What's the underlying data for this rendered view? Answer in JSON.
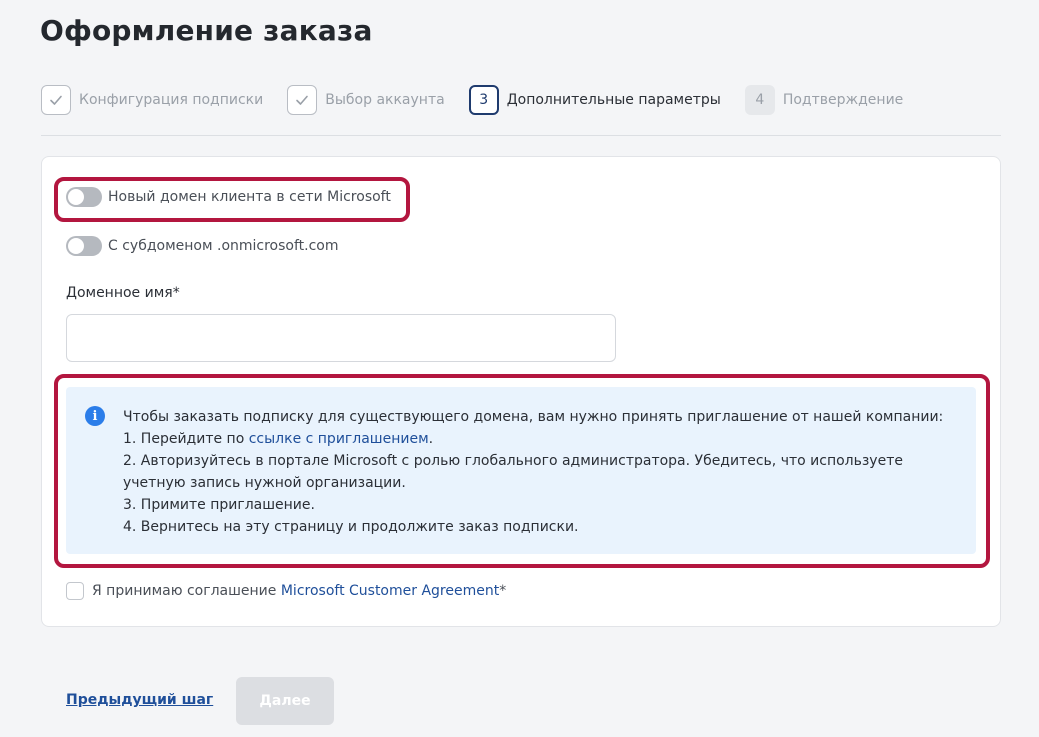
{
  "page": {
    "title": "Оформление заказа"
  },
  "stepper": {
    "steps": [
      {
        "label": "Конфигурация подписки",
        "state": "done",
        "number": ""
      },
      {
        "label": "Выбор аккаунта",
        "state": "done",
        "number": ""
      },
      {
        "label": "Дополнительные параметры",
        "state": "current",
        "number": "3"
      },
      {
        "label": "Подтверждение",
        "state": "future",
        "number": "4"
      }
    ]
  },
  "form": {
    "toggle_new_domain": {
      "label": "Новый домен клиента в сети Microsoft",
      "checked": false
    },
    "toggle_subdomain": {
      "label": "С субдоменом .onmicrosoft.com",
      "checked": false
    },
    "domain_name": {
      "label": "Доменное имя*",
      "value": "",
      "placeholder": ""
    },
    "info": {
      "icon": "info-icon",
      "intro": "Чтобы заказать подписку для существующего домена, вам нужно принять приглашение от нашей компании:",
      "step1_prefix": "1. Перейдите по ",
      "step1_link": "ссылке с приглашением",
      "step1_suffix": ".",
      "step2": "2. Авторизуйтесь в портале Microsoft с ролью глобального администратора. Убедитесь, что используете учетную запись нужной организации.",
      "step3": "3. Примите приглашение.",
      "step4": "4. Вернитесь на эту страницу и продолжите заказ подписки."
    },
    "agreement": {
      "prefix": "Я принимаю соглашение ",
      "link": "Microsoft Customer Agreement",
      "suffix": "*",
      "checked": false
    }
  },
  "footer": {
    "prev_label": "Предыдущий шаг",
    "next_label": "Далее"
  },
  "colors": {
    "accent": "#1f3b6e",
    "link": "#1f4f9a",
    "highlight": "#b3163f",
    "info_bg": "#e9f3fd"
  }
}
